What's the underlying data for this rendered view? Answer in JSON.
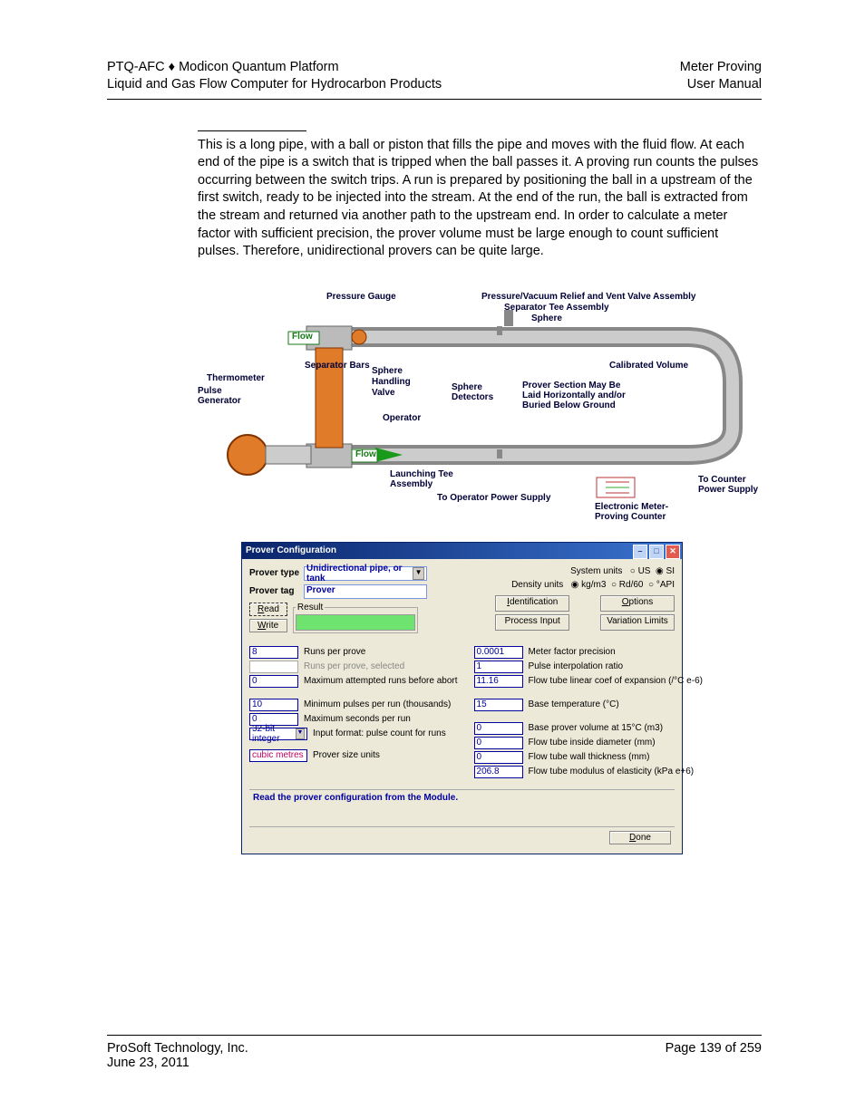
{
  "header": {
    "left1": "PTQ-AFC ♦ Modicon Quantum Platform",
    "left2": "Liquid and Gas Flow Computer for Hydrocarbon Products",
    "right1": "Meter Proving",
    "right2": "User Manual"
  },
  "body": {
    "paragraph": "This is a long pipe, with a ball or piston that fills the pipe and moves with the fluid flow. At each end of the pipe is a switch that is tripped when the ball passes it. A proving run counts the pulses occurring between the switch trips. A run is prepared by positioning the ball in a                    upstream of the first switch, ready to be injected into the stream. At the end of the run, the ball is extracted from the stream and returned via another path to the upstream end. In order to calculate a meter factor with sufficient precision, the prover volume must be large enough to count sufficient pulses. Therefore, unidirectional provers can be quite large."
  },
  "diagram": {
    "labels": {
      "pressure_gauge": "Pressure Gauge",
      "relief": "Pressure/Vacuum Relief and Vent Valve Assembly",
      "septee": "Separator Tee Assembly",
      "sphere": "Sphere",
      "flow": "Flow",
      "sepbars": "Separator Bars",
      "thermo": "Thermometer",
      "pulsegen": "Pulse\nGenerator",
      "sphere2": "Sphere",
      "handling": "Handling",
      "valve": "Valve",
      "operator": "Operator",
      "sdet": "Sphere\nDetectors",
      "calvol": "Calibrated Volume",
      "section": "Prover Section May Be\nLaid Horizontally and/or\nBuried Below Ground",
      "launch": "Launching Tee\nAssembly",
      "toopps": "To Operator Power Supply",
      "tocounter": "To Counter\nPower Supply",
      "emeter": "Electronic Meter-\nProving Counter"
    }
  },
  "dialog": {
    "title": "Prover Configuration",
    "prover_type_label": "Prover type",
    "prover_type_value": "Unidirectional pipe, or tank",
    "prover_tag_label": "Prover tag",
    "prover_tag_value": "Prover",
    "read": "Read",
    "write": "Write",
    "result_legend": "Result",
    "system_units_label": "System units",
    "us": "US",
    "si": "SI",
    "density_units_label": "Density units",
    "kgm3": "kg/m3",
    "rd60": "Rd/60",
    "api": "°API",
    "tabs": {
      "identification": "Identification",
      "options": "Options",
      "process_input": "Process Input",
      "variation_limits": "Variation Limits"
    },
    "left_fields": {
      "runs_per_prove": {
        "value": "8",
        "label": "Runs per prove"
      },
      "runs_selected": {
        "value": "",
        "label": "Runs per prove, selected"
      },
      "max_attempted": {
        "value": "0",
        "label": "Maximum attempted runs before abort"
      },
      "min_pulses": {
        "value": "10",
        "label": "Minimum pulses per run (thousands)"
      },
      "max_seconds": {
        "value": "0",
        "label": "Maximum seconds per run"
      },
      "input_format": {
        "value": "32-bit integer",
        "label": "Input format: pulse count for runs"
      },
      "prover_size": {
        "value": "cubic metres",
        "label": "Prover size units"
      }
    },
    "right_fields": {
      "meter_factor": {
        "value": "0.0001",
        "label": "Meter factor precision"
      },
      "pulse_interp": {
        "value": "1",
        "label": "Pulse interpolation ratio"
      },
      "flow_coef": {
        "value": "11.16",
        "label": "Flow tube linear coef of expansion (/°C e-6)"
      },
      "base_temp": {
        "value": "15",
        "label": "Base temperature (°C)"
      },
      "base_vol": {
        "value": "0",
        "label": "Base prover volume at 15°C (m3)"
      },
      "flow_id": {
        "value": "0",
        "label": "Flow tube inside diameter (mm)"
      },
      "flow_wt": {
        "value": "0",
        "label": "Flow tube wall thickness (mm)"
      },
      "flow_mod": {
        "value": "206.8",
        "label": "Flow tube modulus of elasticity (kPa e+6)"
      }
    },
    "status": "Read the prover configuration from the Module.",
    "done": "Done"
  },
  "footer": {
    "company": "ProSoft Technology, Inc.",
    "date": "June 23, 2011",
    "page": "Page 139 of 259"
  }
}
